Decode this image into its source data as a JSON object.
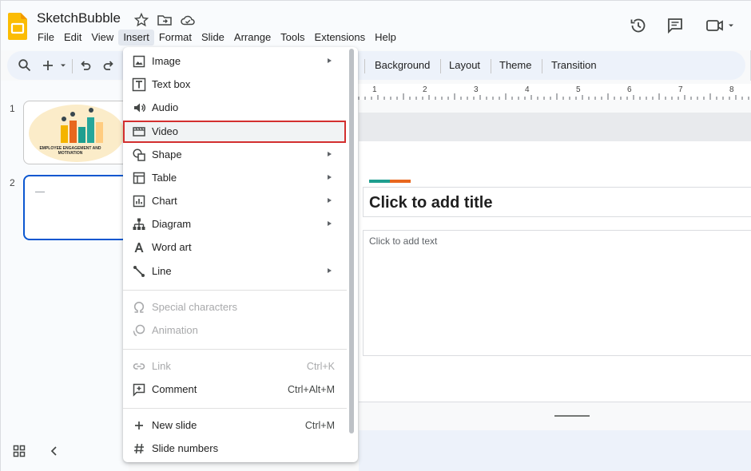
{
  "app": {
    "doc_title": "SketchBubble"
  },
  "menubar": [
    "File",
    "Edit",
    "View",
    "Insert",
    "Format",
    "Slide",
    "Arrange",
    "Tools",
    "Extensions",
    "Help"
  ],
  "toolbar": {
    "background_label": "Background",
    "layout_label": "Layout",
    "theme_label": "Theme",
    "transition_label": "Transition"
  },
  "ruler": [
    "1",
    "2",
    "3",
    "4",
    "5",
    "6",
    "7",
    "8"
  ],
  "slides": [
    {
      "number": "1",
      "caption": "EMPLOYEE ENGAGEMENT AND MOTIVATION"
    },
    {
      "number": "2"
    }
  ],
  "slide": {
    "title_placeholder": "Click to add title",
    "body_placeholder": "Click to add text"
  },
  "insert_menu": {
    "items": [
      {
        "label": "Image",
        "icon": "image-icon",
        "submenu": true
      },
      {
        "label": "Text box",
        "icon": "text-box-icon"
      },
      {
        "label": "Audio",
        "icon": "audio-icon"
      },
      {
        "label": "Video",
        "icon": "video-icon"
      },
      {
        "label": "Shape",
        "icon": "shape-icon",
        "submenu": true
      },
      {
        "label": "Table",
        "icon": "table-icon",
        "submenu": true
      },
      {
        "label": "Chart",
        "icon": "chart-icon",
        "submenu": true
      },
      {
        "label": "Diagram",
        "icon": "diagram-icon",
        "submenu": true
      },
      {
        "label": "Word art",
        "icon": "word-art-icon"
      },
      {
        "label": "Line",
        "icon": "line-icon",
        "submenu": true
      },
      {
        "label": "Special characters",
        "icon": "omega-icon",
        "disabled": true
      },
      {
        "label": "Animation",
        "icon": "animation-icon",
        "disabled": true
      },
      {
        "label": "Link",
        "icon": "link-icon",
        "shortcut": "Ctrl+K",
        "disabled": true
      },
      {
        "label": "Comment",
        "icon": "comment-icon",
        "shortcut": "Ctrl+Alt+M"
      },
      {
        "label": "New slide",
        "icon": "plus-icon",
        "shortcut": "Ctrl+M"
      },
      {
        "label": "Slide numbers",
        "icon": "hash-icon"
      }
    ]
  },
  "colors": {
    "highlight_border": "#d32f2f",
    "selected_slide": "#0b57d0",
    "accent_teal": "#1e9e8f",
    "accent_orange": "#e8671e",
    "logo_yellow": "#fbbc04"
  }
}
